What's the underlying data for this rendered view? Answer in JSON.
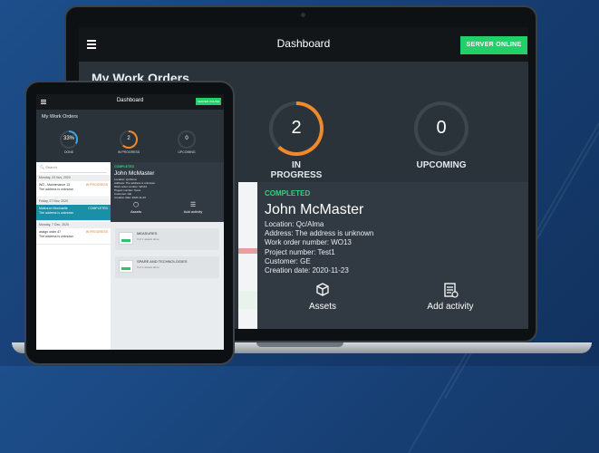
{
  "laptop": {
    "header": {
      "title": "Dashboard",
      "server_status": "SERVER ONLINE"
    },
    "section_title": "My Work Orders",
    "stats": [
      {
        "value": "2",
        "label": "IN PROGRESS",
        "progress": 0.62
      },
      {
        "value": "0",
        "label": "UPCOMING",
        "progress": 0
      }
    ],
    "detail": {
      "status": "COMPLETED",
      "name": "John McMaster",
      "lines": [
        "Location: Qc/Alma",
        "Address: The address is unknown",
        "Work order number: WO13",
        "Project number: Test1",
        "Customer: GE",
        "Creation date: 2020-11-23"
      ],
      "actions": [
        {
          "label": "Assets",
          "icon": "cube-icon"
        },
        {
          "label": "Add activity",
          "icon": "checklist-icon"
        }
      ]
    }
  },
  "tablet": {
    "header": {
      "title": "Dashboard",
      "server_status": "SERVER ONLINE"
    },
    "section_title": "My Work Orders",
    "stats": [
      {
        "value": "33%",
        "label": "DONE",
        "progress": 0.33
      },
      {
        "value": "2",
        "label": "IN PROGRESS",
        "progress": 0.62
      },
      {
        "value": "0",
        "label": "UPCOMING",
        "progress": 0
      }
    ],
    "search_placeholder": "Search",
    "list": [
      {
        "type": "date",
        "text": "Monday, 23 Nov, 2020"
      },
      {
        "type": "item",
        "title": "WO - Maintenance 13",
        "sub": "The address is unknown",
        "meta": "IN PROGRESS"
      },
      {
        "type": "date",
        "text": "Friday, 27 Nov, 2020"
      },
      {
        "type": "item",
        "title": "Maleoron Mochaelte",
        "sub": "The address is unknown",
        "meta": "COMPLETED",
        "selected": true
      },
      {
        "type": "date",
        "text": "Monday, 7 Dec, 2020"
      },
      {
        "type": "item",
        "title": "assign order 47",
        "sub": "The address is unknown",
        "meta": "IN PROGRESS"
      }
    ],
    "detail": {
      "status": "COMPLETED",
      "name": "John McMaster",
      "lines": [
        "Location: Qc/Alma",
        "Address: The address is unknown",
        "Work order number: WO13",
        "Project number: Test1",
        "Customer: GE",
        "Creation date: 2020-11-23"
      ],
      "actions": [
        {
          "label": "Assets"
        },
        {
          "label": "Add activity"
        }
      ]
    },
    "cards": [
      {
        "title": "MEASURES",
        "sub": "0 of 1 assets done"
      },
      {
        "title": "SPARE AND TECHNOLOGIES",
        "sub": "0 of 1 assets done"
      }
    ]
  },
  "colors": {
    "accent_orange": "#f0892b",
    "online_green": "#22d06b",
    "ring_blue": "#3da7e5",
    "status_green": "#35d07a"
  }
}
